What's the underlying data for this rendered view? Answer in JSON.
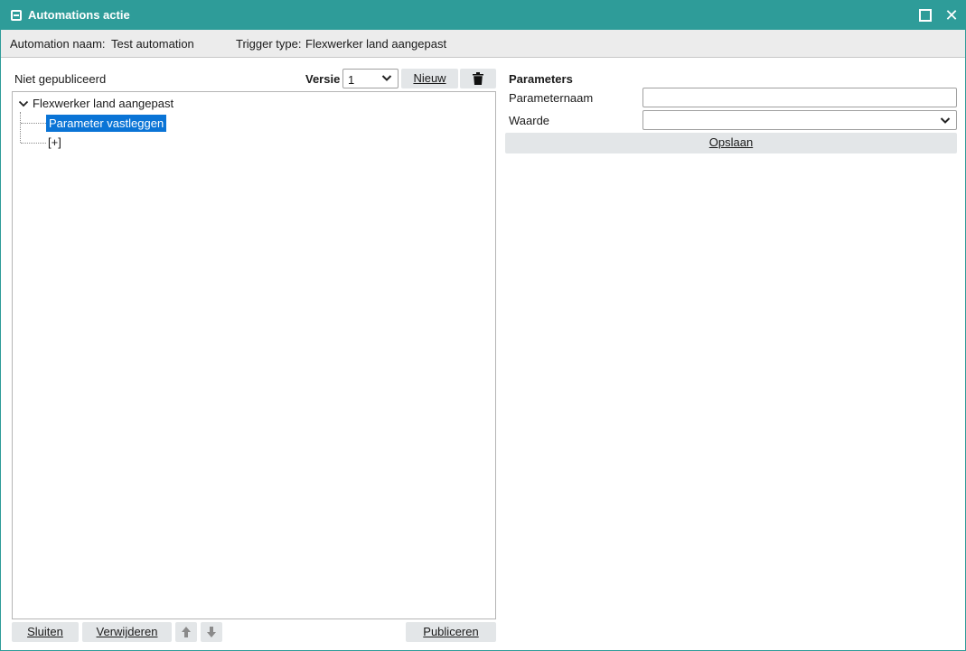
{
  "window": {
    "title": "Automations actie",
    "icons": {
      "app": "app-window-icon",
      "maximize": "maximize-icon",
      "close": "close-icon"
    }
  },
  "info": {
    "automation_label": "Automation naam:",
    "automation_value": "Test automation",
    "trigger_label": "Trigger type:",
    "trigger_value": "Flexwerker land aangepast"
  },
  "left": {
    "status": "Niet gepubliceerd",
    "version_label": "Versie",
    "version_value": "1",
    "new_button": "Nieuw",
    "delete_icon": "trash-icon"
  },
  "tree": {
    "root": "Flexwerker land aangepast",
    "selected": "Parameter vastleggen",
    "add": "[+]"
  },
  "params": {
    "title": "Parameters",
    "name_label": "Parameternaam",
    "name_value": "",
    "value_label": "Waarde",
    "value_selected": "",
    "save_button": "Opslaan"
  },
  "footer": {
    "close_button": "Sluiten",
    "remove_button": "Verwijderen",
    "up_icon": "arrow-up-icon",
    "down_icon": "arrow-down-icon",
    "publish_button": "Publiceren"
  },
  "colors": {
    "titlebar": "#2e9c99",
    "selection": "#0a74d6",
    "button": "#e3e6e8",
    "infobar": "#ececec"
  }
}
